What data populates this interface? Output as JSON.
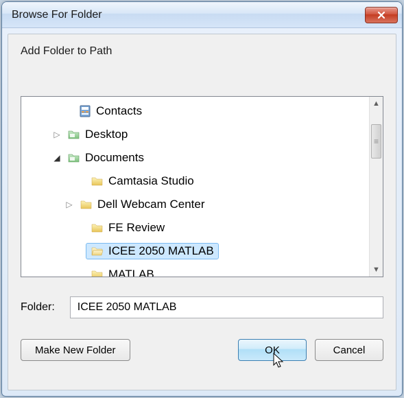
{
  "window": {
    "title": "Browse For Folder"
  },
  "instruction": "Add Folder to Path",
  "tree": [
    {
      "indent": 60,
      "expander": "",
      "icon": "contacts",
      "label": "Contacts",
      "selected": false
    },
    {
      "indent": 44,
      "expander": "▷",
      "icon": "folder-sys",
      "label": "Desktop",
      "selected": false
    },
    {
      "indent": 44,
      "expander": "◢",
      "icon": "folder-sys",
      "label": "Documents",
      "selected": false
    },
    {
      "indent": 78,
      "expander": "",
      "icon": "folder",
      "label": "Camtasia Studio",
      "selected": false
    },
    {
      "indent": 62,
      "expander": "▷",
      "icon": "folder",
      "label": "Dell Webcam Center",
      "selected": false
    },
    {
      "indent": 78,
      "expander": "",
      "icon": "folder",
      "label": "FE Review",
      "selected": false
    },
    {
      "indent": 78,
      "expander": "",
      "icon": "folder-open",
      "label": "ICEE 2050 MATLAB",
      "selected": true
    },
    {
      "indent": 78,
      "expander": "",
      "icon": "folder",
      "label": "MATLAB",
      "selected": false
    }
  ],
  "folderRow": {
    "label": "Folder:",
    "value": "ICEE 2050 MATLAB"
  },
  "buttons": {
    "makeNew": "Make New Folder",
    "ok": "OK",
    "cancel": "Cancel"
  }
}
